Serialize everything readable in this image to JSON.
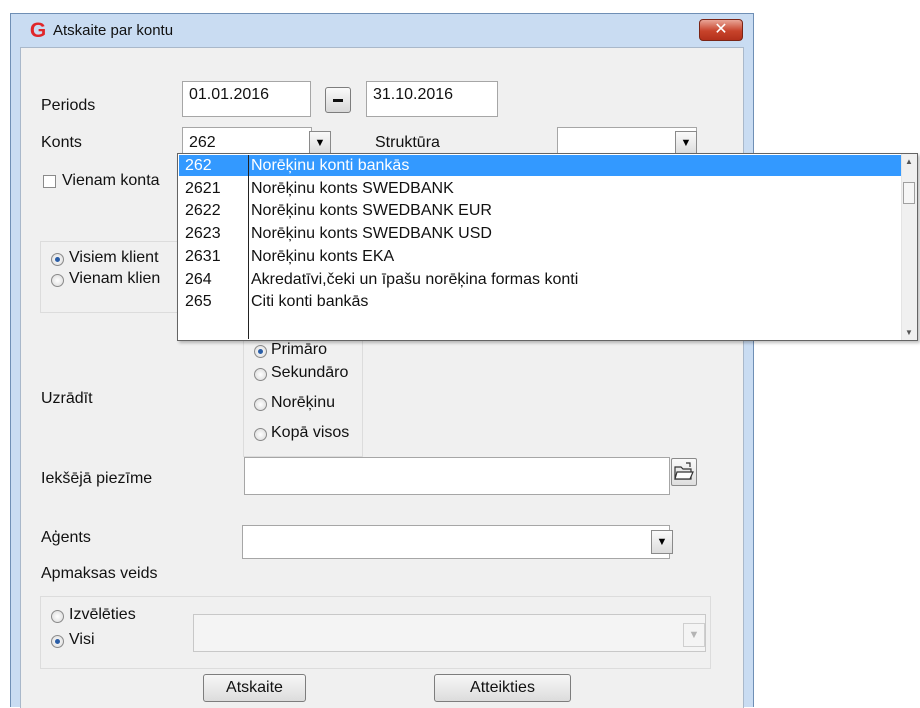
{
  "window": {
    "title": "Atskaite par kontu",
    "close_symbol": "✕",
    "app_icon": "G"
  },
  "form": {
    "periods_label": "Periods",
    "date_from": "01.01.2016",
    "date_to": "31.10.2016",
    "konts_label": "Konts",
    "konts_value": "262",
    "struktura_label": "Struktūra",
    "struktura_value": "",
    "vienam_kontam_label": "Vienam konta",
    "clients_radio": [
      {
        "label": "Visiem klient",
        "checked": true
      },
      {
        "label": "Vienam klien",
        "checked": false
      }
    ],
    "uzradit_label": "Uzrādīt",
    "uzradit_options": [
      {
        "label": "Primāro",
        "checked": true
      },
      {
        "label": "Sekundāro",
        "checked": false
      },
      {
        "label": "Norēķinu",
        "checked": false
      },
      {
        "label": "Kopā visos",
        "checked": false
      }
    ],
    "iekseja_piezime_label": "Iekšējā piezīme",
    "iekseja_piezime_value": "",
    "agents_label": "Aģents",
    "agents_value": "",
    "apmaksas_veids_label": "Apmaksas veids",
    "apmaksas_options": [
      {
        "label": "Izvēlēties",
        "checked": false
      },
      {
        "label": "Visi",
        "checked": true
      }
    ],
    "apmaksas_select_value": ""
  },
  "buttons": {
    "report": "Atskaite",
    "cancel": "Atteikties"
  },
  "dropdown_list": [
    {
      "code": "262",
      "name": "Norēķinu konti bankās",
      "selected": true
    },
    {
      "code": "2621",
      "name": "Norēķinu konts SWEDBANK",
      "selected": false
    },
    {
      "code": "2622",
      "name": "Norēķinu konts SWEDBANK EUR",
      "selected": false
    },
    {
      "code": "2623",
      "name": "Norēķinu konts SWEDBANK USD",
      "selected": false
    },
    {
      "code": "2631",
      "name": "Norēķinu konts EKA",
      "selected": false
    },
    {
      "code": "264",
      "name": "Akredatīvi,čeki un īpašu norēķina formas konti",
      "selected": false
    },
    {
      "code": "265",
      "name": "Citi konti bankās",
      "selected": false
    }
  ],
  "colors": {
    "selection": "#3399ff",
    "window_frame": "#c9dcf2",
    "close_button": "#c7432b"
  },
  "icons": {
    "close": "close-icon",
    "dropdown": "chevron-down-icon",
    "folder": "folder-open-icon"
  }
}
